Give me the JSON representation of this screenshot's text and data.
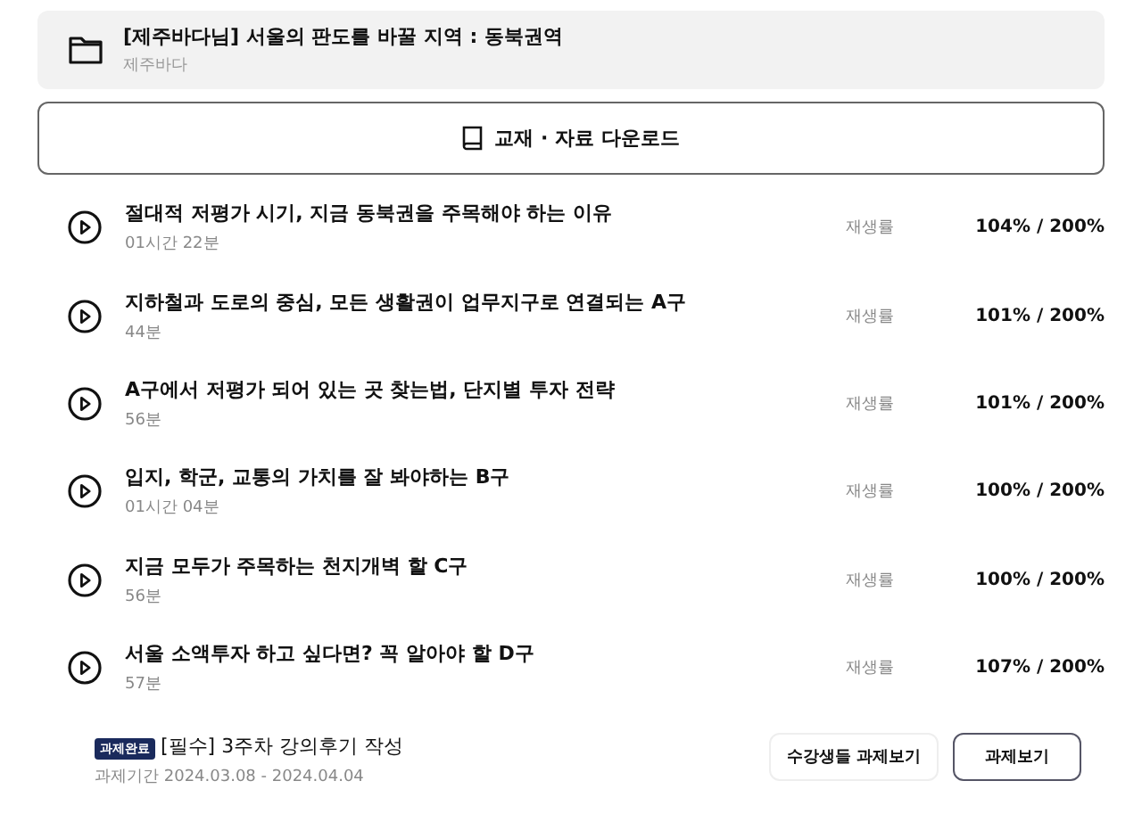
{
  "course": {
    "title": "[제주바다님] 서울의 판도를 바꿀 지역 : 동북권역",
    "subtitle": "제주바다"
  },
  "download_button": "교재 · 자료 다운로드",
  "lessons": [
    {
      "title": "절대적 저평가 시기, 지금 동북권을 주목해야 하는 이유",
      "duration": "01시간 22분",
      "rate_label": "재생률",
      "rate": "104% / 200%"
    },
    {
      "title": "지하철과 도로의 중심, 모든 생활권이 업무지구로 연결되는 A구",
      "duration": "44분",
      "rate_label": "재생률",
      "rate": "101% / 200%"
    },
    {
      "title": "A구에서 저평가 되어 있는 곳 찾는법, 단지별 투자 전략",
      "duration": "56분",
      "rate_label": "재생률",
      "rate": "101% / 200%"
    },
    {
      "title": "입지, 학군, 교통의 가치를 잘 봐야하는 B구",
      "duration": "01시간 04분",
      "rate_label": "재생률",
      "rate": "100% / 200%"
    },
    {
      "title": "지금 모두가 주목하는 천지개벽 할 C구",
      "duration": "56분",
      "rate_label": "재생률",
      "rate": "100% / 200%"
    },
    {
      "title": "서울 소액투자 하고 싶다면? 꼭 알아야 할 D구",
      "duration": "57분",
      "rate_label": "재생률",
      "rate": "107% / 200%"
    }
  ],
  "assignment": {
    "badge": "과제완료",
    "title": "[필수] 3주차 강의후기 작성",
    "period": "과제기간 2024.03.08 - 2024.04.04",
    "buttons": [
      "수강생들 과제보기",
      "과제보기"
    ]
  }
}
